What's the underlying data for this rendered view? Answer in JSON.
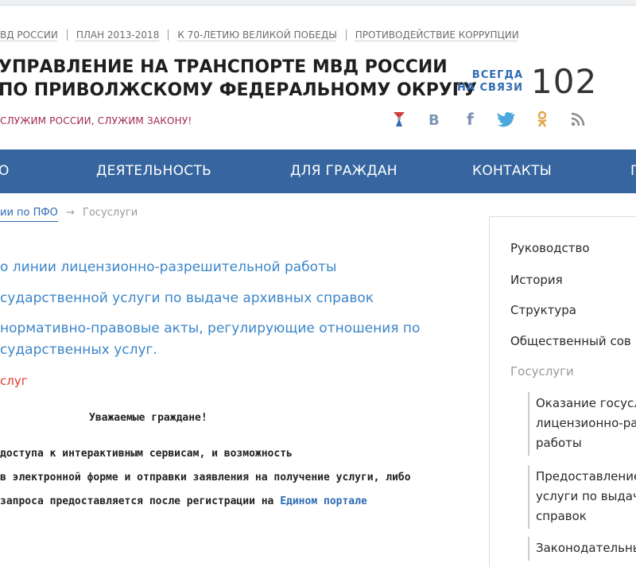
{
  "topbar": {
    "links": [
      "ВД РОССИИ",
      "ПЛАН 2013-2018",
      "К 70-ЛЕТИЮ ВЕЛИКОЙ ПОБЕДЫ",
      "ПРОТИВОДЕЙСТВИЕ КОРРУПЦИИ"
    ]
  },
  "header": {
    "title_line1": "УПРАВЛЕНИЕ НА ТРАНСПОРТЕ МВД РОССИИ",
    "title_line2": "ПО ПРИВОЛЖСКОМУ ФЕДЕРАЛЬНОМУ ОКРУГУ",
    "slogan": "СЛУЖИМ РОССИИ, СЛУЖИМ ЗАКОНУ!",
    "hotline_label_1": "ВСЕГДА",
    "hotline_label_2": "НА СВЯЗИ",
    "hotline_number": "102"
  },
  "social_icons": [
    "mvd-icon",
    "vk-icon",
    "facebook-icon",
    "twitter-icon",
    "odnoklassniki-icon",
    "rss-icon"
  ],
  "nav": {
    "items": [
      "О",
      "ДЕЯТЕЛЬНОСТЬ",
      "ДЛЯ ГРАЖДАН",
      "КОНТАКТЫ",
      "П"
    ]
  },
  "breadcrumb": {
    "item1": "ии по ПФО",
    "arrow": "→",
    "current": "Госуслуги"
  },
  "main_links": [
    "о линии лицензионно-разрешительной работы",
    "сударственной услуги по выдаче архивных справок",
    "нормативно-правовые акты, регулирующие отношения по",
    "сударственных услуг.",
    "слуг"
  ],
  "notice": {
    "heading": "Уважаемые граждане!",
    "line1": "доступа к интерактивным сервисам, и возможность",
    "line2": "в электронной форме и отправки заявления на получение услуги, либо",
    "line3_prefix": "запроса предоставляется после регистрации на ",
    "line3_link": "Едином портале"
  },
  "sidebar": {
    "items": [
      "Руководство",
      "История",
      "Структура",
      "Общественный сов",
      "Госуслуги"
    ],
    "sub1": [
      "Оказание госусл",
      "лицензионно-ра",
      "работы"
    ],
    "sub2": [
      "Предоставление",
      "услуги по выдач",
      "справок"
    ],
    "sub3": [
      "Законодательны"
    ]
  },
  "colors": {
    "nav_bg": "#36659f",
    "link": "#3b86c9",
    "slogan": "#a02b4a",
    "accent_red": "#e23b2e"
  }
}
